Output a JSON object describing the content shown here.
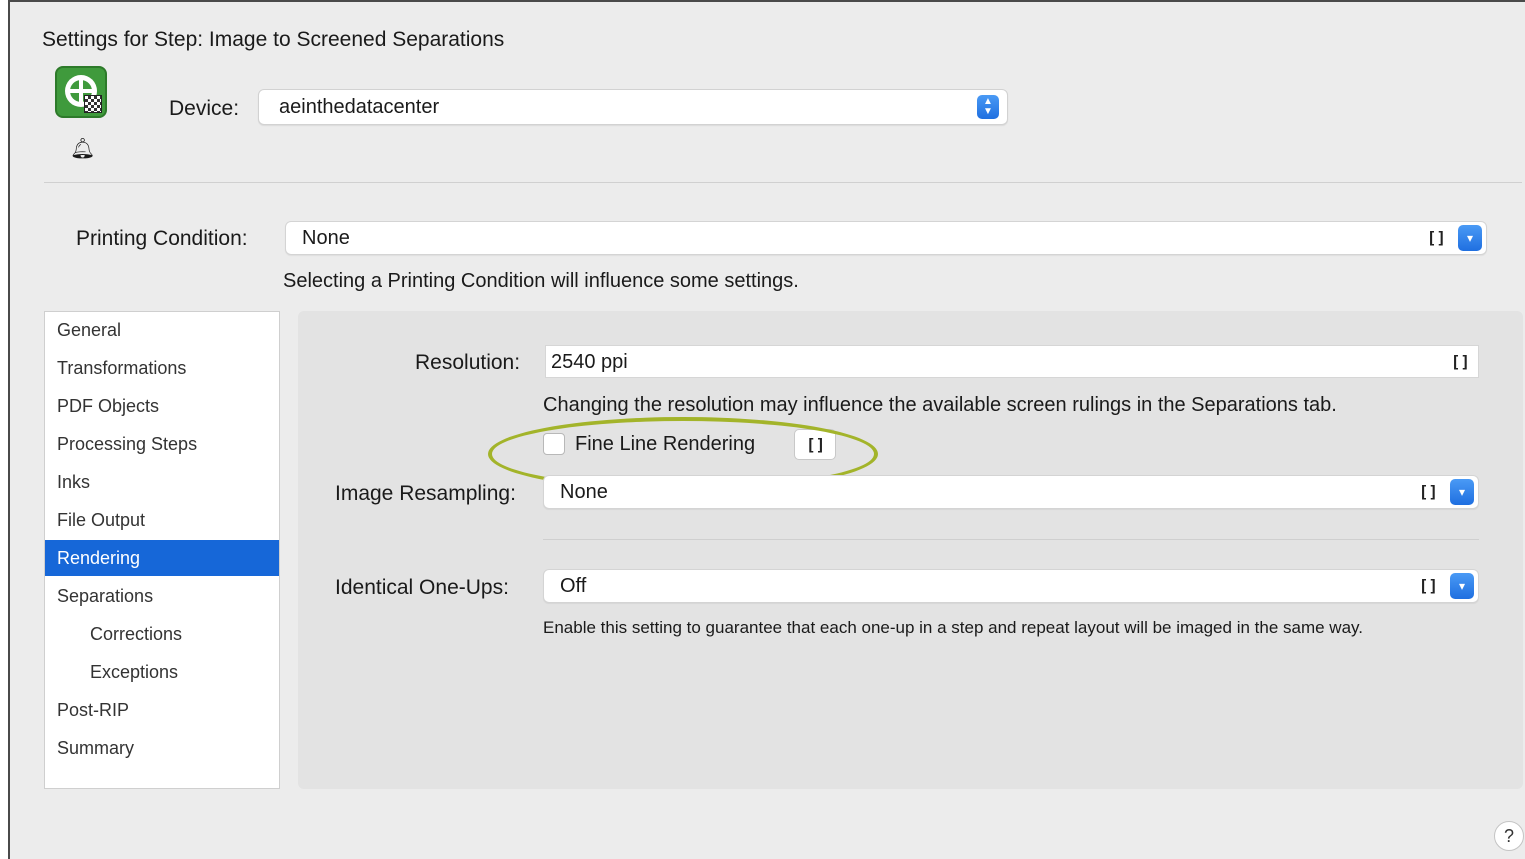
{
  "window": {
    "title": "Settings for Step: Image to Screened Separations"
  },
  "device": {
    "label": "Device:",
    "value": "aeinthedatacenter"
  },
  "printing_condition": {
    "label": "Printing Condition:",
    "value": "None",
    "lock": "[]",
    "note": "Selecting a Printing Condition will influence some settings."
  },
  "sidebar": {
    "items": [
      {
        "label": "General"
      },
      {
        "label": "Transformations"
      },
      {
        "label": "PDF Objects"
      },
      {
        "label": "Processing Steps"
      },
      {
        "label": "Inks"
      },
      {
        "label": "File Output"
      },
      {
        "label": "Rendering",
        "selected": true
      },
      {
        "label": "Separations"
      },
      {
        "label": "Corrections",
        "indent": true
      },
      {
        "label": "Exceptions",
        "indent": true
      },
      {
        "label": "Post-RIP"
      },
      {
        "label": "Summary"
      }
    ]
  },
  "rendering": {
    "resolution": {
      "label": "Resolution:",
      "value": "2540 ppi",
      "lock": "[]",
      "note": "Changing the resolution may influence the available screen rulings in the Separations tab."
    },
    "fine_line": {
      "label": "Fine Line Rendering",
      "checked": false,
      "lock": "[]"
    },
    "image_resampling": {
      "label": "Image Resampling:",
      "value": "None",
      "lock": "[]"
    },
    "identical_one_ups": {
      "label": "Identical One-Ups:",
      "value": "Off",
      "lock": "[]",
      "note": "Enable this setting to guarantee that each one-up in a step and repeat layout will be imaged in the same way."
    }
  },
  "help": {
    "label": "?"
  },
  "colors": {
    "accent": "#1667d8",
    "highlight_ellipse": "#a3b42a",
    "app_icon": "#3f9a3c"
  },
  "icons": {
    "app": "screening-app-icon",
    "bell": "bell-icon",
    "stepper": "up-down-stepper-icon",
    "chevron": "chevron-down-icon",
    "lock": "lock-brackets-icon"
  }
}
